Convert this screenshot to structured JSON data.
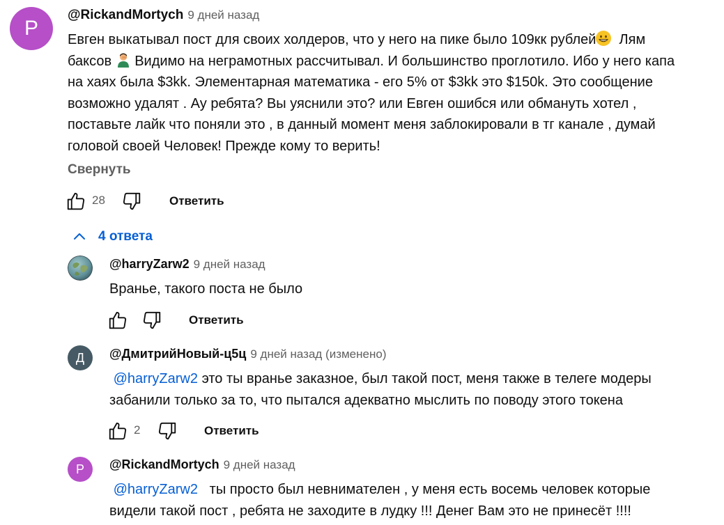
{
  "comment": {
    "avatar_letter": "P",
    "avatar_color": "#b64fc8",
    "author": "@RickandMortych",
    "time": "9 дней назад",
    "lines": [
      "Евген выкатывал пост для своих холдеров, что у него на пике было 109кк рублей",
      "баксов",
      "Видимо на неграмотных рассчитывал. И большинство проглотило. Ибо у него капа",
      "на хаях была $3kk. Элементарная математика - его 5% от $3kk это $150k. Это сообщение",
      "возможно удалят . Ау ребята? Вы уяснили это? или Евген ошибся или обмануть хотел ,",
      "поставьте лайк что поняли это , в данный момент меня заблокировали в тг канале , думай",
      "головой своей Человек! Прежде кому то верить!"
    ],
    "line1_tail": "Лям",
    "collapse_label": "Свернуть",
    "likes": "28",
    "reply_label": "Ответить"
  },
  "replies_toggle": {
    "label": "4 ответа",
    "accent": "#065fd4"
  },
  "replies": [
    {
      "avatar_letter": "",
      "avatar_kind": "globe",
      "author": "@harryZarw2",
      "time": "9 дней назад",
      "lines": [
        "Вранье, такого поста не было"
      ],
      "likes": "",
      "reply_label": "Ответить"
    },
    {
      "avatar_letter": "Д",
      "avatar_color": "#455a64",
      "author": "@ДмитрийНовый-ц5ц",
      "time": "9 дней назад (изменено)",
      "mention": "@harryZarw2",
      "lines": [
        "это ты вранье заказное, был такой пост, меня также в телеге модеры",
        "забанили только за то, что пытался адекватно мыслить по поводу этого токена"
      ],
      "likes": "2",
      "reply_label": "Ответить"
    },
    {
      "avatar_letter": "P",
      "avatar_color": "#b64fc8",
      "author": "@RickandMortych",
      "time": "9 дней назад",
      "mention": "@harryZarw2",
      "lines": [
        "ты просто был невнимателен , у меня есть восемь человек которые",
        "видели такой пост , ребята не заходите в лудку !!! Денег Вам это не принесёт !!!!"
      ]
    }
  ]
}
